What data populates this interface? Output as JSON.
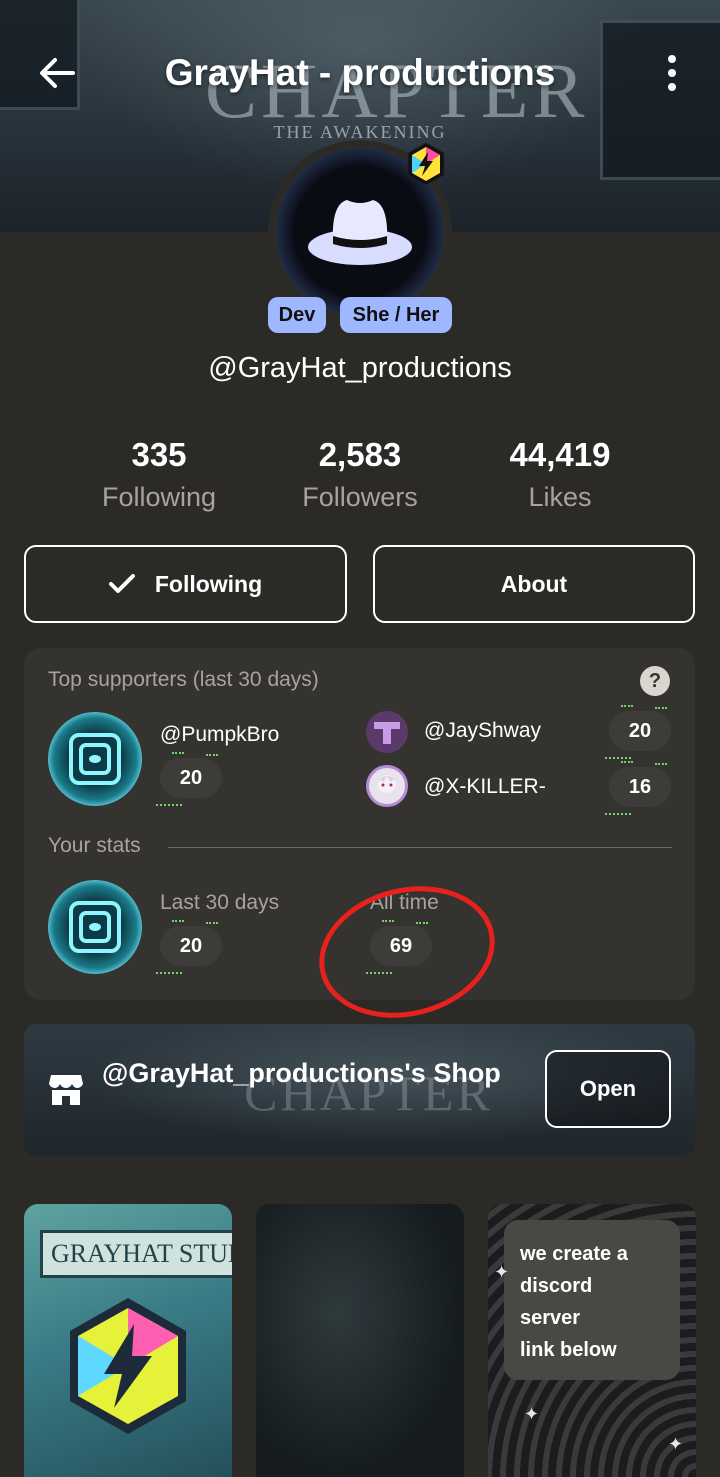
{
  "header": {
    "title": "GrayHat - productions",
    "banner_text": "CHAPTER",
    "banner_subtext": "THE AWAKENING",
    "back_icon": "arrow-left-icon",
    "more_icon": "more-vertical-icon"
  },
  "profile": {
    "handle": "@GrayHat_productions",
    "tags": [
      "Dev",
      "She / Her"
    ],
    "badge_icon": "lightning-hex-badge-icon"
  },
  "stats": [
    {
      "value": "335",
      "label": "Following"
    },
    {
      "value": "2,583",
      "label": "Followers"
    },
    {
      "value": "44,419",
      "label": "Likes"
    }
  ],
  "actions": {
    "following_label": "Following",
    "about_label": "About"
  },
  "supporters": {
    "title": "Top supporters (last 30 days)",
    "top": {
      "name": "@PumpkBro",
      "count": "20"
    },
    "others": [
      {
        "name": "@JayShway",
        "count": "20"
      },
      {
        "name": "@X-KILLER-",
        "count": "16"
      }
    ],
    "your_stats_label": "Your stats",
    "last_30_label": "Last 30 days",
    "last_30_value": "20",
    "all_time_label": "All time",
    "all_time_value": "69"
  },
  "shop": {
    "title": "@GrayHat_productions's Shop",
    "open_label": "Open",
    "bg_text": "CHAPTER"
  },
  "posts": {
    "post1_banner": "GRAYHAT STUDIO",
    "post3_text": "we create a\ndiscord\nserver\nlink below"
  },
  "colors": {
    "background": "#2b2a27",
    "card": "#353330",
    "tag": "#9fb7ff",
    "annotation": "#e8211d"
  }
}
